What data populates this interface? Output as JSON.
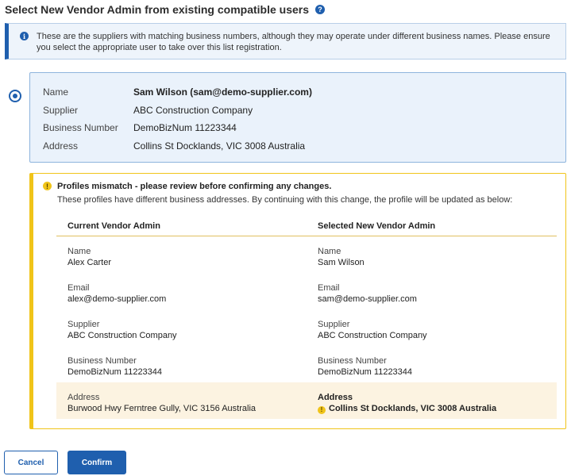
{
  "page": {
    "title": "Select New Vendor Admin from existing compatible users",
    "help_icon": "question-circle-icon"
  },
  "info": {
    "icon": "info-circle-icon",
    "text": "These are the suppliers with matching business numbers, although they may operate under different business names. Please ensure you select the appropriate user to take over this list registration."
  },
  "candidate": {
    "selected": true,
    "rows": [
      {
        "label": "Name",
        "value": "Sam Wilson (sam@demo-supplier.com)"
      },
      {
        "label": "Supplier",
        "value": "ABC Construction Company"
      },
      {
        "label": "Business Number",
        "value": "DemoBizNum 11223344"
      },
      {
        "label": "Address",
        "value": "Collins St Docklands, VIC 3008 Australia"
      }
    ]
  },
  "mismatch": {
    "icon": "warning-circle-icon",
    "title": "Profiles mismatch - please review before confirming any changes.",
    "subtitle": "These profiles have different business addresses. By continuing with this change, the profile will be updated as below:",
    "headers": {
      "current": "Current Vendor Admin",
      "selected": "Selected New Vendor Admin"
    },
    "rows": [
      {
        "label": "Name",
        "current": "Alex Carter",
        "selected": "Sam Wilson"
      },
      {
        "label": "Email",
        "current": "alex@demo-supplier.com",
        "selected": "sam@demo-supplier.com"
      },
      {
        "label": "Supplier",
        "current": "ABC Construction Company",
        "selected": "ABC Construction Company"
      },
      {
        "label": "Business Number",
        "current": "DemoBizNum 11223344",
        "selected": "DemoBizNum 11223344"
      },
      {
        "label": "Address",
        "current": "Burwood Hwy Ferntree Gully, VIC 3156 Australia",
        "selected": "Collins St Docklands, VIC 3008 Australia",
        "highlight": true
      }
    ]
  },
  "buttons": {
    "cancel": "Cancel",
    "confirm": "Confirm"
  },
  "colors": {
    "primary": "#1f5fae",
    "warning": "#f0c419",
    "highlight_row": "#fcf3e1",
    "card_bg": "#eaf2fb"
  }
}
